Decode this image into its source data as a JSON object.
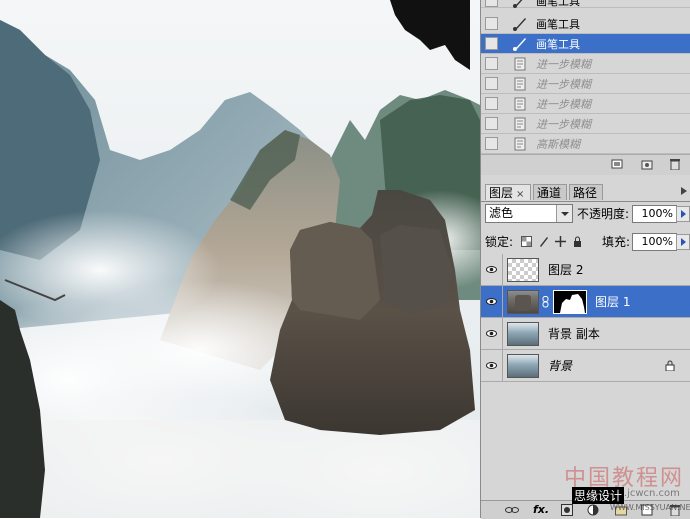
{
  "history": {
    "items": [
      {
        "label": "画笔工具",
        "state": "normal",
        "icon": "brush-icon"
      },
      {
        "label": "画笔工具",
        "state": "normal",
        "icon": "brush-icon"
      },
      {
        "label": "画笔工具",
        "state": "selected",
        "icon": "brush-icon"
      },
      {
        "label": "进一步模糊",
        "state": "dimmed",
        "icon": "document-icon"
      },
      {
        "label": "进一步模糊",
        "state": "dimmed",
        "icon": "document-icon"
      },
      {
        "label": "进一步模糊",
        "state": "dimmed",
        "icon": "document-icon"
      },
      {
        "label": "进一步模糊",
        "state": "dimmed",
        "icon": "document-icon"
      },
      {
        "label": "高斯模糊",
        "state": "dimmed",
        "icon": "document-icon"
      }
    ]
  },
  "tabs": [
    {
      "label": "图层",
      "active": true
    },
    {
      "label": "通道",
      "active": false
    },
    {
      "label": "路径",
      "active": false
    }
  ],
  "tab_close_symbol": "×",
  "layers_panel": {
    "blend_mode": "滤色",
    "opacity_label": "不透明度:",
    "opacity_value": "100%",
    "lock_label": "锁定:",
    "fill_label": "填充:",
    "fill_value": "100%"
  },
  "layers": [
    {
      "name": "图层 2",
      "thumb": "transparent",
      "selected": false,
      "has_mask": false,
      "locked": false,
      "italic": false
    },
    {
      "name": "图层 1",
      "thumb": "rock",
      "selected": true,
      "has_mask": true,
      "locked": false,
      "italic": false
    },
    {
      "name": "背景 副本",
      "thumb": "mountain",
      "selected": false,
      "has_mask": false,
      "locked": false,
      "italic": false
    },
    {
      "name": "背景",
      "thumb": "mountain",
      "selected": false,
      "has_mask": false,
      "locked": true,
      "italic": true
    }
  ],
  "bottom_bar": {
    "fx_label": "fx."
  },
  "watermark": {
    "line1": "中国教程网",
    "line2": "bbs.jcwcn.com",
    "line3": "思缘设计",
    "line4": "WWW.MISSYUAN.NET"
  },
  "colors": {
    "selection": "#3b6fc8",
    "panel_bg": "#d6d6d6",
    "sky": "#eef2f4"
  }
}
